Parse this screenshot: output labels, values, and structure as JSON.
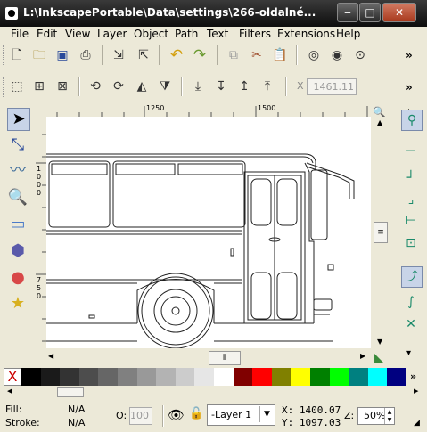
{
  "window": {
    "title": "L:\\InkscapePortable\\Data\\settings\\266-oldalné...",
    "minimize": "‒",
    "maximize": "□",
    "close": "✕"
  },
  "menu": [
    "File",
    "Edit",
    "View",
    "Layer",
    "Object",
    "Path",
    "Text",
    "Filters",
    "Extensions",
    "Help"
  ],
  "toolbar1": {
    "icons": [
      "new-document-icon",
      "open-icon",
      "save-icon",
      "print-icon",
      "import-icon",
      "export-icon",
      "undo-icon",
      "redo-icon",
      "copy-icon",
      "cut-icon",
      "paste-icon",
      "zoom-selection-icon",
      "zoom-drawing-icon",
      "zoom-page-icon"
    ],
    "overflow": "»"
  },
  "toolbar2": {
    "icons": [
      "select-all-icon",
      "select-all-layers-icon",
      "deselect-icon",
      "rotate-ccw-icon",
      "rotate-cw-icon",
      "flip-horizontal-icon",
      "flip-vertical-icon",
      "lower-bottom-icon",
      "lower-icon",
      "raise-icon",
      "raise-top-icon"
    ],
    "x_label": "X",
    "x_value": "1461.11",
    "overflow": "»"
  },
  "tools": [
    "selector-tool-icon",
    "node-tool-icon",
    "tweak-tool-icon",
    "zoom-tool-icon",
    "rectangle-tool-icon",
    "3d-box-tool-icon",
    "ellipse-tool-icon",
    "star-tool-icon"
  ],
  "snap_tools": [
    "snap-toggle-icon",
    "snap-bbox-icon",
    "snap-bbox-edge-icon",
    "snap-bbox-corner-icon",
    "snap-bbox-midpoint-icon",
    "snap-center-icon",
    "snap-nodes-icon",
    "snap-paths-icon",
    "snap-intersection-icon"
  ],
  "rulers": {
    "h_label": "1250",
    "h_label2": "1500",
    "v_label": "1000",
    "v_label2": "750"
  },
  "palette": {
    "none_label": "X",
    "colors": [
      "#000000",
      "#1a1a1a",
      "#333333",
      "#4d4d4d",
      "#666666",
      "#808080",
      "#999999",
      "#b3b3b3",
      "#cccccc",
      "#e6e6e6",
      "#ffffff",
      "#800000",
      "#ff0000",
      "#808000",
      "#ffff00",
      "#008000",
      "#00ff00",
      "#008080",
      "#00ffff",
      "#000080"
    ]
  },
  "status": {
    "fill_label": "Fill:",
    "fill_value": "N/A",
    "stroke_label": "Stroke:",
    "stroke_value": "N/A",
    "opacity_label": "O:",
    "opacity_value": "100",
    "layer": "-Layer 1",
    "x_coord": "X: 1400.07",
    "y_coord": "Y: 1097.03",
    "zoom_label": "Z:",
    "zoom_value": "50%"
  }
}
